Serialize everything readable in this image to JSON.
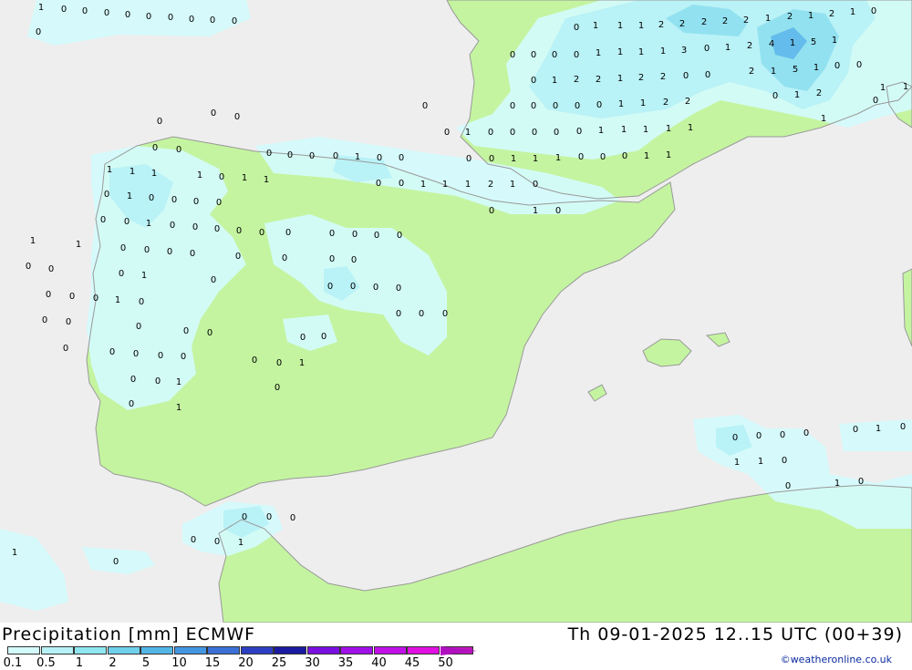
{
  "title": "Precipitation [mm] ECMWF",
  "valid_time": "Th 09-01-2025 12..15 UTC (00+39)",
  "credit": "©weatheronline.co.uk",
  "colors": {
    "sea": "#eeeeee",
    "land": "#c4f4a0",
    "coast": "#999999",
    "rain_0_1": "#d4fbfc",
    "rain_0_5": "#b6f1f6",
    "rain_2": "#8edfef",
    "rain_5": "#5fb8ea"
  },
  "legend": {
    "labels": [
      "0.1",
      "0.5",
      "1",
      "2",
      "5",
      "10",
      "15",
      "20",
      "25",
      "30",
      "35",
      "40",
      "45",
      "50"
    ],
    "colors": [
      "#d4fbfc",
      "#b6f1f6",
      "#8ee7f0",
      "#6fd0ec",
      "#52b6e6",
      "#4396e0",
      "#3a6fd6",
      "#2c3fc2",
      "#1a1aa0",
      "#7a10e0",
      "#a010e8",
      "#c010e6",
      "#e010e0",
      "#c018b8"
    ]
  },
  "map_values": [
    {
      "v": "1"
    },
    {
      "v": "0"
    },
    {
      "v": "0"
    },
    {
      "v": "0"
    },
    {
      "v": "0"
    },
    {
      "v": "0"
    },
    {
      "v": "0"
    },
    {
      "v": "0"
    },
    {
      "v": "0"
    },
    {
      "v": "0"
    },
    {
      "v": "0"
    },
    {
      "v": "0"
    },
    {
      "v": "0"
    },
    {
      "v": "0"
    },
    {
      "v": "0"
    },
    {
      "v": "0"
    },
    {
      "v": "0"
    },
    {
      "v": "0"
    },
    {
      "v": "1"
    },
    {
      "v": "1"
    },
    {
      "v": "1"
    },
    {
      "v": "2"
    },
    {
      "v": "2"
    },
    {
      "v": "2"
    },
    {
      "v": "2"
    },
    {
      "v": "2"
    },
    {
      "v": "1"
    },
    {
      "v": "2"
    },
    {
      "v": "1"
    },
    {
      "v": "2"
    },
    {
      "v": "1"
    },
    {
      "v": "0"
    },
    {
      "v": "0"
    },
    {
      "v": "0"
    },
    {
      "v": "0"
    },
    {
      "v": "0"
    },
    {
      "v": "1"
    },
    {
      "v": "1"
    },
    {
      "v": "1"
    },
    {
      "v": "1"
    },
    {
      "v": "3"
    },
    {
      "v": "0"
    },
    {
      "v": "1"
    },
    {
      "v": "2"
    },
    {
      "v": "4"
    },
    {
      "v": "1"
    },
    {
      "v": "5"
    },
    {
      "v": "1"
    },
    {
      "v": "0"
    },
    {
      "v": "1"
    },
    {
      "v": "2"
    },
    {
      "v": "2"
    },
    {
      "v": "1"
    },
    {
      "v": "2"
    },
    {
      "v": "2"
    },
    {
      "v": "0"
    },
    {
      "v": "0"
    },
    {
      "v": "2"
    },
    {
      "v": "1"
    },
    {
      "v": "5"
    },
    {
      "v": "1"
    },
    {
      "v": "0"
    },
    {
      "v": "0"
    },
    {
      "v": "0"
    },
    {
      "v": "1"
    },
    {
      "v": "2"
    },
    {
      "v": "1"
    },
    {
      "v": "1"
    },
    {
      "v": "0"
    },
    {
      "v": "0"
    },
    {
      "v": "0"
    },
    {
      "v": "0"
    },
    {
      "v": "0"
    },
    {
      "v": "1"
    },
    {
      "v": "1"
    },
    {
      "v": "2"
    },
    {
      "v": "2"
    },
    {
      "v": "1"
    },
    {
      "v": "0"
    },
    {
      "v": "0"
    },
    {
      "v": "1"
    },
    {
      "v": "0"
    },
    {
      "v": "0"
    },
    {
      "v": "0"
    },
    {
      "v": "0"
    },
    {
      "v": "0"
    },
    {
      "v": "1"
    },
    {
      "v": "1"
    },
    {
      "v": "1"
    },
    {
      "v": "1"
    },
    {
      "v": "1"
    },
    {
      "v": "0"
    },
    {
      "v": "0"
    },
    {
      "v": "0"
    },
    {
      "v": "0"
    },
    {
      "v": "1"
    },
    {
      "v": "0"
    },
    {
      "v": "0"
    },
    {
      "v": "0"
    },
    {
      "v": "0"
    },
    {
      "v": "1"
    },
    {
      "v": "1"
    },
    {
      "v": "1"
    },
    {
      "v": "0"
    },
    {
      "v": "0"
    },
    {
      "v": "0"
    },
    {
      "v": "1"
    },
    {
      "v": "1"
    },
    {
      "v": "0"
    },
    {
      "v": "0"
    },
    {
      "v": "1"
    },
    {
      "v": "1"
    },
    {
      "v": "1"
    },
    {
      "v": "2"
    },
    {
      "v": "1"
    },
    {
      "v": "0"
    },
    {
      "v": "1"
    },
    {
      "v": "1"
    },
    {
      "v": "1"
    },
    {
      "v": "1"
    },
    {
      "v": "0"
    },
    {
      "v": "1"
    },
    {
      "v": "1"
    },
    {
      "v": "0"
    },
    {
      "v": "1"
    },
    {
      "v": "0"
    },
    {
      "v": "0"
    },
    {
      "v": "1"
    },
    {
      "v": "0"
    },
    {
      "v": "0"
    },
    {
      "v": "0"
    },
    {
      "v": "0"
    },
    {
      "v": "0"
    },
    {
      "v": "0"
    },
    {
      "v": "1"
    },
    {
      "v": "0"
    },
    {
      "v": "0"
    },
    {
      "v": "0"
    },
    {
      "v": "0"
    },
    {
      "v": "0"
    },
    {
      "v": "1"
    },
    {
      "v": "1"
    },
    {
      "v": "0"
    },
    {
      "v": "0"
    },
    {
      "v": "0"
    },
    {
      "v": "0"
    },
    {
      "v": "0"
    },
    {
      "v": "0"
    },
    {
      "v": "0"
    },
    {
      "v": "0"
    },
    {
      "v": "0"
    },
    {
      "v": "0"
    },
    {
      "v": "0"
    },
    {
      "v": "0"
    },
    {
      "v": "0"
    },
    {
      "v": "0"
    },
    {
      "v": "1"
    },
    {
      "v": "0"
    },
    {
      "v": "0"
    },
    {
      "v": "0"
    },
    {
      "v": "0"
    },
    {
      "v": "0"
    },
    {
      "v": "0"
    },
    {
      "v": "1"
    },
    {
      "v": "0"
    },
    {
      "v": "0"
    },
    {
      "v": "0"
    },
    {
      "v": "0"
    },
    {
      "v": "0"
    },
    {
      "v": "0"
    },
    {
      "v": "0"
    },
    {
      "v": "0"
    },
    {
      "v": "0"
    },
    {
      "v": "0"
    },
    {
      "v": "0"
    },
    {
      "v": "0"
    },
    {
      "v": "0"
    },
    {
      "v": "0"
    },
    {
      "v": "0"
    },
    {
      "v": "0"
    },
    {
      "v": "0"
    },
    {
      "v": "0"
    },
    {
      "v": "0"
    },
    {
      "v": "0"
    },
    {
      "v": "1"
    },
    {
      "v": "0"
    },
    {
      "v": "0"
    },
    {
      "v": "1"
    },
    {
      "v": "0"
    },
    {
      "v": "0"
    },
    {
      "v": "0"
    },
    {
      "v": "1"
    },
    {
      "v": "0"
    },
    {
      "v": "0"
    },
    {
      "v": "0"
    },
    {
      "v": "0"
    },
    {
      "v": "0"
    },
    {
      "v": "1"
    },
    {
      "v": "1"
    },
    {
      "v": "0"
    },
    {
      "v": "0"
    },
    {
      "v": "1"
    },
    {
      "v": "0"
    },
    {
      "v": "0"
    },
    {
      "v": "1"
    },
    {
      "v": "0"
    },
    {
      "v": "0"
    },
    {
      "v": "0"
    },
    {
      "v": "0"
    },
    {
      "v": "0"
    },
    {
      "v": "0"
    },
    {
      "v": "1"
    },
    {
      "v": "1"
    },
    {
      "v": "0"
    }
  ]
}
